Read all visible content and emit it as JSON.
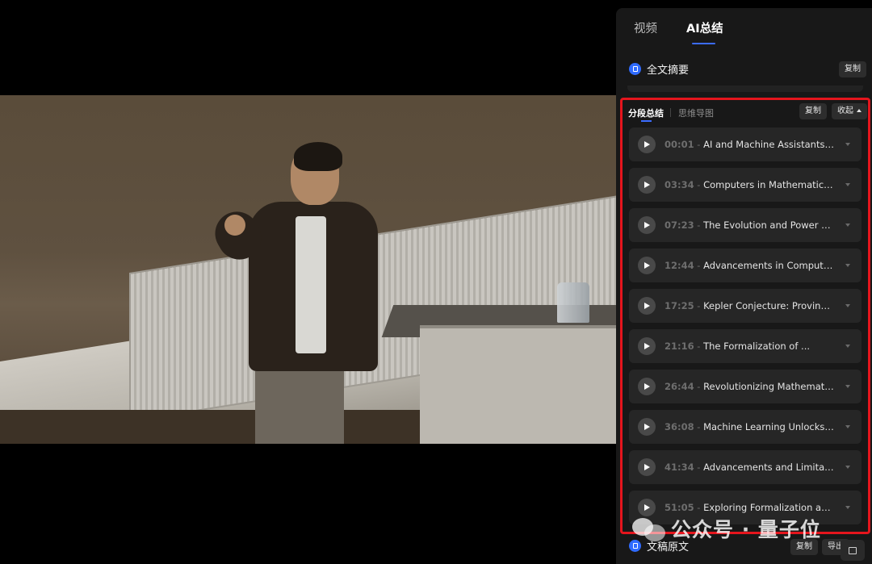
{
  "panel": {
    "tabs": [
      {
        "label": "视频"
      },
      {
        "label": "AI总结",
        "active": true
      }
    ],
    "full_summary": {
      "title": "全文摘要",
      "copy_label": "复制"
    },
    "segments": {
      "tabs": [
        {
          "label": "分段总结",
          "active": true
        },
        {
          "label": "思维导图"
        }
      ],
      "copy_label": "复制",
      "collapse_label": "收起",
      "items": [
        {
          "time": "00:01",
          "title": "AI and Machine Assistants ..."
        },
        {
          "time": "03:34",
          "title": "Computers in Mathematics: ..."
        },
        {
          "time": "07:23",
          "title": "The Evolution and Power of ..."
        },
        {
          "time": "12:44",
          "title": "Advancements in Computer-..."
        },
        {
          "time": "17:25",
          "title": "Kepler Conjecture: Proving t..."
        },
        {
          "time": "21:16",
          "title": "The Formalization of ..."
        },
        {
          "time": "26:44",
          "title": "Revolutionizing Mathematic..."
        },
        {
          "time": "36:08",
          "title": "Machine Learning Unlocks ..."
        },
        {
          "time": "41:34",
          "title": "Advancements and Limitatio..."
        },
        {
          "time": "51:05",
          "title": "Exploring Formalization and ..."
        }
      ]
    },
    "transcript": {
      "title": "文稿原文",
      "copy_label": "复制",
      "export_label": "导出"
    }
  },
  "watermark": {
    "text": "公众号 · 量子位"
  },
  "colors": {
    "accent": "#3b6cff",
    "highlight_border": "#e5151d"
  }
}
